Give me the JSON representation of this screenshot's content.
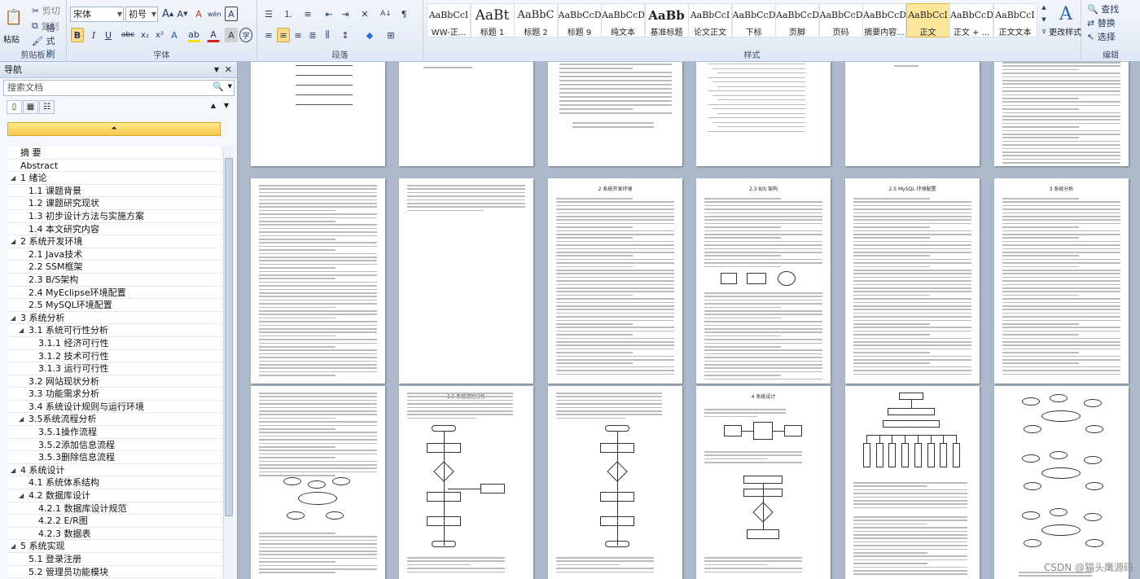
{
  "ribbon": {
    "clipboard": {
      "paste": "粘贴",
      "cut": "剪切",
      "copy": "复制",
      "format_painter": "格式刷",
      "group_label": "剪贴板"
    },
    "font": {
      "family": "宋体",
      "size": "初号",
      "group_label": "字体",
      "grow": "A",
      "shrink": "A",
      "clear": "A",
      "pinyin": "wén",
      "border_char": "A",
      "bold": "B",
      "italic": "I",
      "underline": "U",
      "strike": "abc",
      "sub": "x₂",
      "sup": "x²",
      "effects": "A",
      "highlight": "ab",
      "color": "A",
      "shade": "A",
      "circle": "字"
    },
    "paragraph": {
      "group_label": "段落",
      "sort": "A↓",
      "marks": "¶"
    },
    "styles": {
      "group_label": "样式",
      "items": [
        {
          "preview": "AaBbCcI",
          "name": "WW-正..."
        },
        {
          "preview": "AaBt",
          "name": "标题 1"
        },
        {
          "preview": "AaBbC",
          "name": "标题 2"
        },
        {
          "preview": "AaBbCcD",
          "name": "标题 9"
        },
        {
          "preview": "AaBbCcD",
          "name": "纯文本"
        },
        {
          "preview": "AaBb",
          "name": "基准标题"
        },
        {
          "preview": "AaBbCcI",
          "name": "论文正文"
        },
        {
          "preview": "AaBbCcDdI",
          "name": "下标"
        },
        {
          "preview": "AaBbCcDdI",
          "name": "页脚"
        },
        {
          "preview": "AaBbCcD",
          "name": "页码"
        },
        {
          "preview": "AaBbCcDdI",
          "name": "摘要内容..."
        },
        {
          "preview": "AaBbCcI",
          "name": "正文"
        },
        {
          "preview": "AaBbCcD",
          "name": "正文 + ..."
        },
        {
          "preview": "AaBbCcI",
          "name": "正文文本"
        }
      ],
      "change_styles": "更改样式"
    },
    "editing": {
      "group_label": "编辑",
      "find": "查找",
      "replace": "替换",
      "select": "选择"
    }
  },
  "nav": {
    "title": "导航",
    "search_placeholder": "搜索文档",
    "items": [
      {
        "text": "摘  要",
        "level": 0
      },
      {
        "text": "Abstract",
        "level": 0
      },
      {
        "text": "1 绪论",
        "level": 0,
        "tw": true
      },
      {
        "text": "1.1 课题背景",
        "level": 1
      },
      {
        "text": "1.2 课题研究现状",
        "level": 1
      },
      {
        "text": "1.3 初步设计方法与实施方案",
        "level": 1
      },
      {
        "text": "1.4 本文研究内容",
        "level": 1
      },
      {
        "text": "2 系统开发环境",
        "level": 0,
        "tw": true
      },
      {
        "text": "2.1 Java技术",
        "level": 1
      },
      {
        "text": "2.2 SSM框架",
        "level": 1
      },
      {
        "text": "2.3 B/S架构",
        "level": 1
      },
      {
        "text": "2.4 MyEclipse环境配置",
        "level": 1
      },
      {
        "text": "2.5 MySQL环境配置",
        "level": 1
      },
      {
        "text": "3 系统分析",
        "level": 0,
        "tw": true
      },
      {
        "text": "3.1 系统可行性分析",
        "level": 1,
        "tw": true
      },
      {
        "text": "3.1.1 经济可行性",
        "level": 2
      },
      {
        "text": "3.1.2 技术可行性",
        "level": 2
      },
      {
        "text": "3.1.3 运行可行性",
        "level": 2
      },
      {
        "text": "3.2 网站现状分析",
        "level": 1
      },
      {
        "text": "3.3 功能需求分析",
        "level": 1
      },
      {
        "text": "3.4 系统设计规则与运行环境",
        "level": 1
      },
      {
        "text": "3.5系统流程分析",
        "level": 1,
        "tw": true
      },
      {
        "text": "3.5.1操作流程",
        "level": 2
      },
      {
        "text": "3.5.2添加信息流程",
        "level": 2
      },
      {
        "text": "3.5.3删除信息流程",
        "level": 2
      },
      {
        "text": "4 系统设计",
        "level": 0,
        "tw": true
      },
      {
        "text": "4.1 系统体系结构",
        "level": 1
      },
      {
        "text": "4.2 数据库设计",
        "level": 1,
        "tw": true
      },
      {
        "text": "4.2.1 数据库设计规范",
        "level": 2
      },
      {
        "text": "4.2.2  E/R图",
        "level": 2
      },
      {
        "text": "4.2.3 数据表",
        "level": 2
      },
      {
        "text": "5 系统实现",
        "level": 0,
        "tw": true
      },
      {
        "text": "5.1 登录注册",
        "level": 1
      },
      {
        "text": "5.2 管理员功能模块",
        "level": 1
      }
    ]
  },
  "pages": {
    "row2": [
      {
        "title": "",
        "body": "在当今网络技术迅速发展的时代，计算机技术已经深入到社会的各个领域，利用计算机进行管理已经成为一种趋势。本系统采用Java技术，SSM框架，MySQL数据库进行开发。"
      },
      {
        "title": "",
        "body": "系统采用B/S结构，用户通过浏览器即可访问系统，无需安装客户端。"
      },
      {
        "title": "2 系统开发环境",
        "body": "2.1 Java技术\nJava是一种面向对象的编程语言，具有跨平台、安全性高等优点。"
      },
      {
        "title": "2.3 B/S 架构",
        "body": "B/S架构即浏览器和服务器架构模式，是随着Internet技术的兴起而产生的一种网络结构模式。"
      },
      {
        "title": "2.5 MySQL 环境配置",
        "body": "MySQL是一个关系型数据库管理系统，体积小、速度快、成本低。"
      },
      {
        "title": "3 系统分析",
        "body": "3.1 系统可行性分析\n3.1.1 经济可行性\n3.1.2 技术可行性\n3.1.3 运行可行性\n3.2 网站现状分析"
      }
    ],
    "row3": [
      {
        "title": "",
        "body": "功能需求分析主要从用户角度出发，分析系统需要实现的功能。"
      },
      {
        "title": "3.5 系统流程分析",
        "body": "3.5.1 操作流程"
      },
      {
        "title": "",
        "body": "3.5.3 删除信息流程"
      },
      {
        "title": "4 系统设计",
        "body": "4.1 系统体系结构"
      },
      {
        "title": "",
        "body": "4.2 数据库设计"
      },
      {
        "title": "",
        "body": "E/R图"
      }
    ]
  },
  "watermark": "CSDN @猫头鹰源码"
}
